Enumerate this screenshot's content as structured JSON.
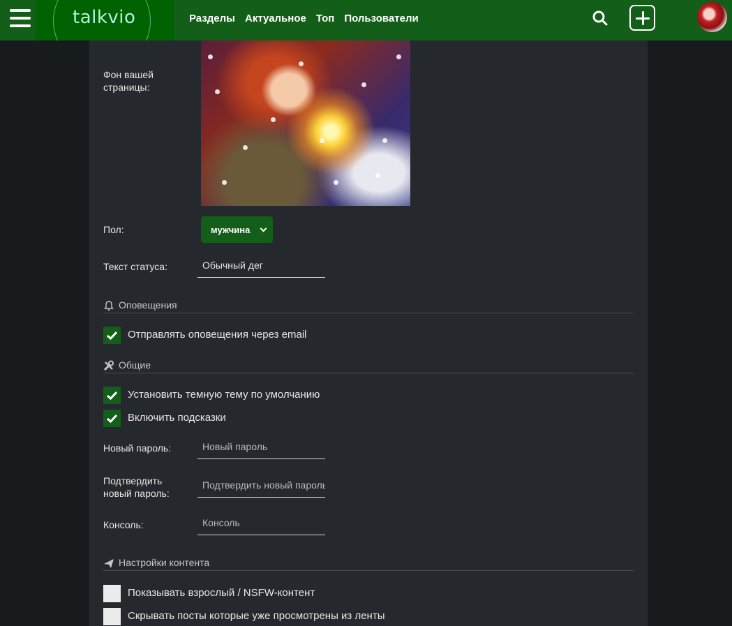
{
  "header": {
    "logo": "talkvio",
    "nav": [
      "Разделы",
      "Актуальное",
      "Топ",
      "Пользователи"
    ],
    "icons": {
      "menu": "hamburger-icon",
      "search": "search-icon",
      "add": "plus-icon",
      "avatar": "user-avatar"
    }
  },
  "profile": {
    "background_label": "Фон вашей страницы:",
    "gender_label": "Пол:",
    "gender_value": "мужчина",
    "status_label": "Текст статуса:",
    "status_value": "Обычный дег"
  },
  "notifications": {
    "title": "Оповещения",
    "icon": "bell-icon",
    "options": [
      {
        "label": "Отправлять оповещения через email",
        "checked": true
      }
    ]
  },
  "general": {
    "title": "Общие",
    "icon": "tools-icon",
    "options": [
      {
        "label": "Установить темную тему по умолчанию",
        "checked": true
      },
      {
        "label": "Включить подсказки",
        "checked": true
      }
    ],
    "new_password_label": "Новый пароль:",
    "new_password_placeholder": "Новый пароль",
    "confirm_password_label": "Подтвердить новый пароль:",
    "confirm_password_placeholder": "Подтвердить новый пароль",
    "console_label": "Консоль:",
    "console_placeholder": "Консоль"
  },
  "content": {
    "title": "Настройки контента",
    "icon": "paper-plane-icon",
    "options": [
      {
        "label": "Показывать взрослый / NSFW-контент",
        "checked": false
      },
      {
        "label": "Скрывать посты которые уже просмотрены из ленты",
        "checked": false
      }
    ]
  },
  "colors": {
    "brand_green": "#135e19",
    "logo_green": "#006200",
    "panel": "#25282c",
    "page_bg": "#181b1e"
  }
}
